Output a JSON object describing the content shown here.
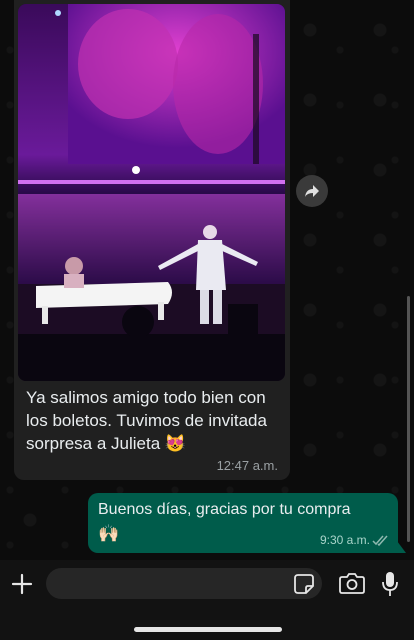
{
  "incoming_message": {
    "text": "Ya salimos amigo todo bien con los boletos. Tuvimos de invitada sorpresa a Julieta 😻",
    "time": "12:47 a.m."
  },
  "outgoing_message": {
    "text": "Buenos días, gracias por tu compra",
    "emoji": "🙌🏻",
    "time": "9:30 a.m.",
    "status": "read"
  },
  "input": {
    "value": "",
    "placeholder": ""
  },
  "icons": {
    "forward": "forward-icon",
    "plus": "plus-icon",
    "sticker": "sticker-icon",
    "camera": "camera-icon",
    "mic": "microphone-icon"
  },
  "colors": {
    "incoming_bubble": "#202020",
    "outgoing_bubble": "#005c4b",
    "background": "#0c0c0c"
  }
}
